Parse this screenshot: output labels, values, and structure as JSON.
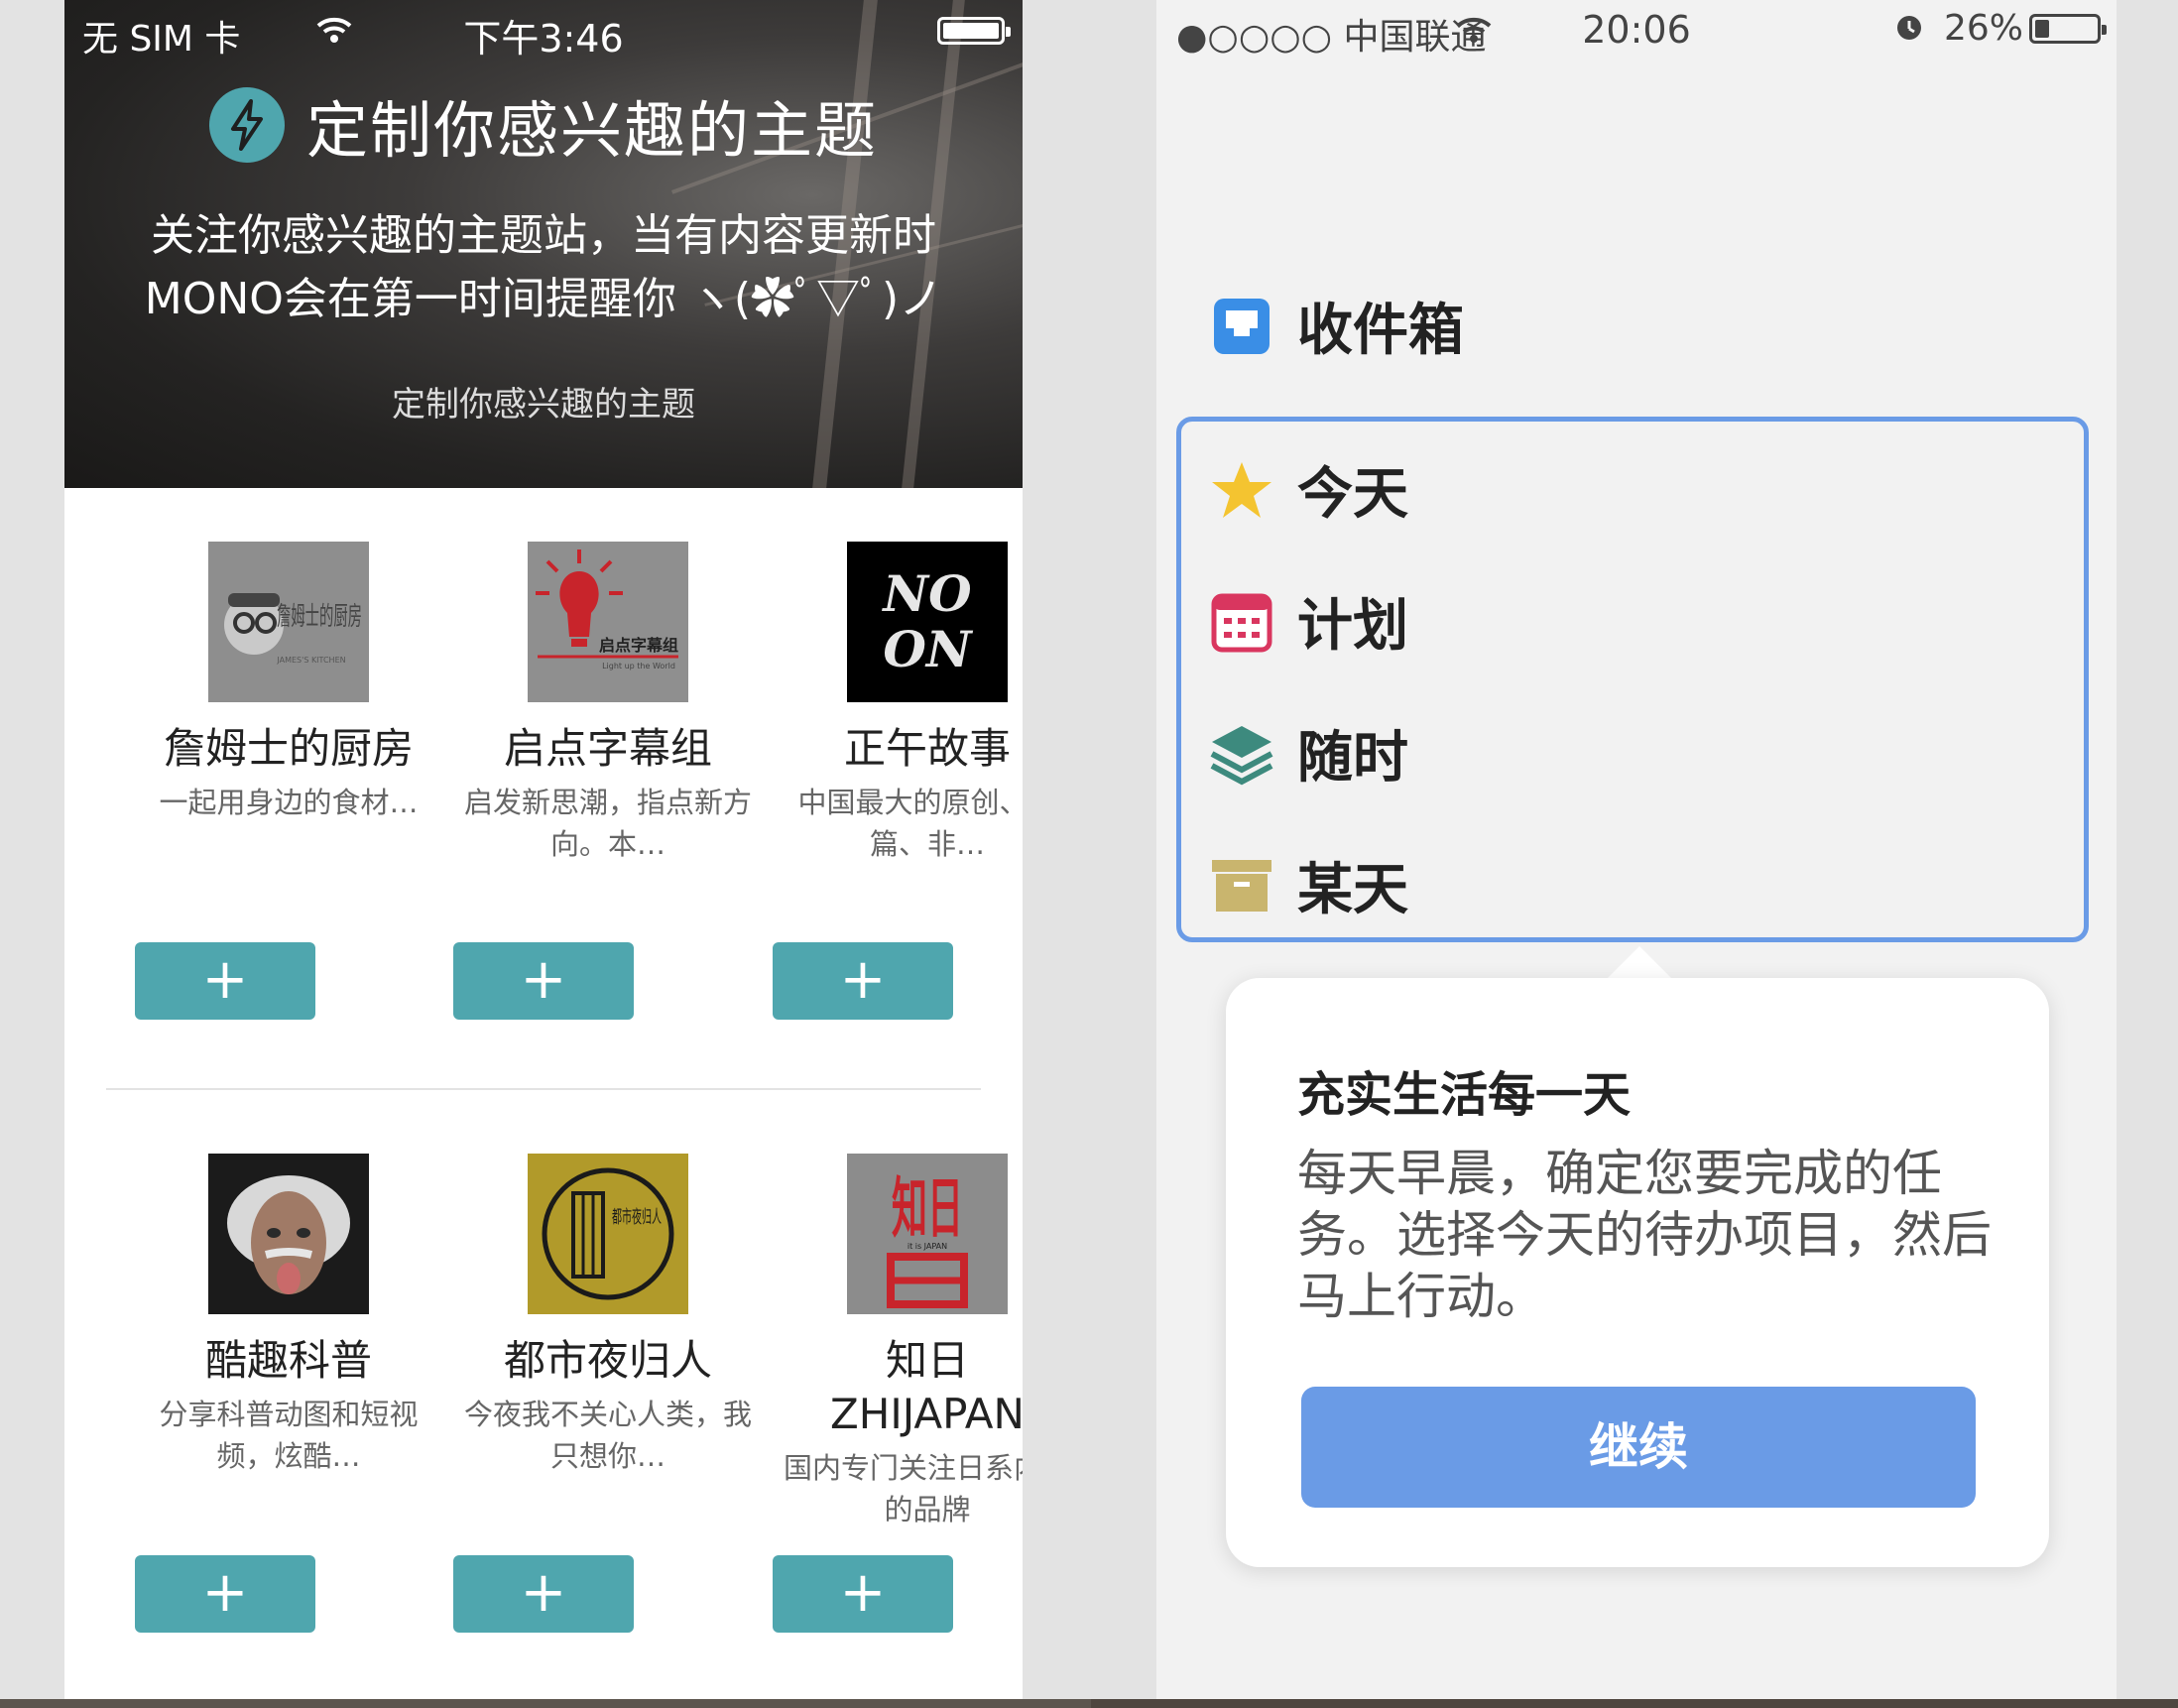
{
  "left_phone": {
    "status_bar": {
      "carrier": "无 SIM 卡",
      "time": "下午3:46"
    },
    "header": {
      "title": "定制你感兴趣的主题",
      "description_line1": "关注你感兴趣的主题站，当有内容更新时",
      "description_line2": "MONO会在第一时间提醒你 ヽ(✿ﾟ▽ﾟ)ノ",
      "subtitle": "定制你感兴趣的主题"
    },
    "add_button_label": "+",
    "topics": [
      {
        "name": "詹姆士的厨房",
        "desc": "一起用身边的食材…",
        "thumb_text": "詹姆士的厨房",
        "thumb_sub": "JAMES'S KITCHEN"
      },
      {
        "name": "启点字幕组",
        "desc": "启发新思潮，指点新方向。本…",
        "thumb_text": "启点字幕组",
        "thumb_sub": "Light up the World"
      },
      {
        "name": "正午故事",
        "desc": "中国最大的原创、长篇、非…",
        "thumb_text": "NO ON"
      },
      {
        "name": "酷趣科普",
        "desc": "分享科普动图和短视频，炫酷…",
        "thumb_text": ""
      },
      {
        "name": "都市夜归人",
        "desc": "今夜我不关心人类，我只想你…",
        "thumb_text": "都市夜归人"
      },
      {
        "name": "知日ZHIJAPAN",
        "desc": "国内专门关注日系内容的品牌",
        "thumb_text": "知日",
        "thumb_sub": "it is JAPAN"
      }
    ]
  },
  "right_phone": {
    "status_bar": {
      "signal": "●○○○○",
      "carrier": "中国联通",
      "time": "20:06",
      "battery": "26%"
    },
    "inbox_label": "收件箱",
    "menu": [
      {
        "label": "今天",
        "icon": "star-icon"
      },
      {
        "label": "计划",
        "icon": "calendar-icon"
      },
      {
        "label": "随时",
        "icon": "layers-icon"
      },
      {
        "label": "某天",
        "icon": "archive-box-icon"
      }
    ],
    "tooltip": {
      "title": "充实生活每一天",
      "body": "每天早晨，确定您要完成的任务。选择今天的待办项目，然后马上行动。",
      "button": "继续"
    },
    "colors": {
      "accent": "#6a9be6",
      "teal": "#4fa6ae"
    }
  }
}
